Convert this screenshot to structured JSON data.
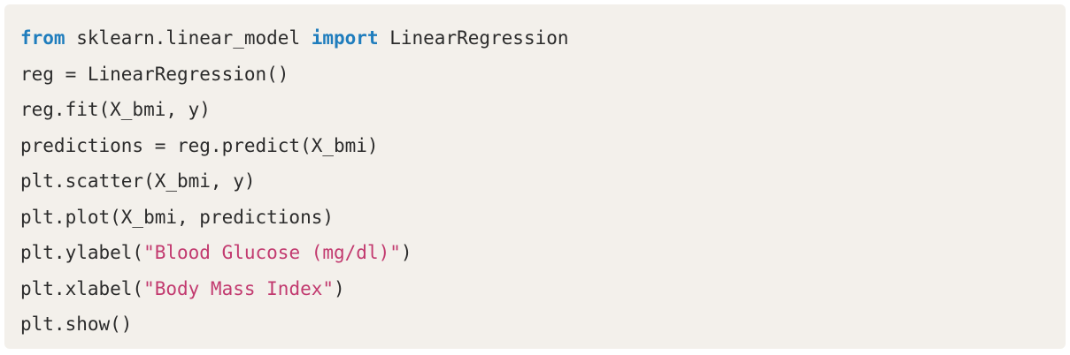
{
  "code": {
    "line1": {
      "kw_from": "from",
      "module": " sklearn.linear_model ",
      "kw_import": "import",
      "name": " LinearRegression"
    },
    "line2": "reg = LinearRegression()",
    "line3": "reg.fit(X_bmi, y)",
    "line4": "predictions = reg.predict(X_bmi)",
    "line5": "plt.scatter(X_bmi, y)",
    "line6": "plt.plot(X_bmi, predictions)",
    "line7": {
      "before": "plt.ylabel(",
      "string": "\"Blood Glucose (mg/dl)\"",
      "after": ")"
    },
    "line8": {
      "before": "plt.xlabel(",
      "string": "\"Body Mass Index\"",
      "after": ")"
    },
    "line9": "plt.show()"
  },
  "colors": {
    "background": "#f3f0eb",
    "keyword": "#1f7dbd",
    "string": "#c23a6f",
    "text": "#2b2b2b"
  }
}
